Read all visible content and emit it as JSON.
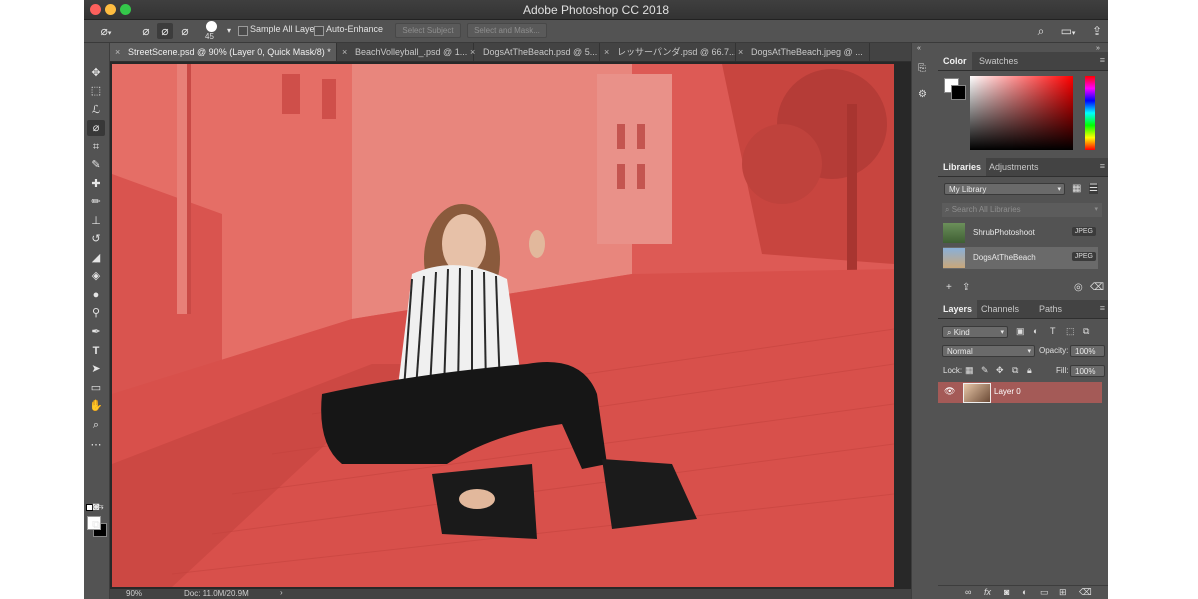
{
  "window": {
    "title": "Adobe Photoshop CC 2018"
  },
  "options_bar": {
    "brush_size": "45",
    "sample_all_layers_label": "Sample All Layers",
    "auto_enhance_label": "Auto-Enhance",
    "select_subject_label": "Select Subject",
    "select_and_mask_label": "Select and Mask..."
  },
  "tabs": [
    {
      "label": "StreetScene.psd @ 90% (Layer 0, Quick Mask/8) *"
    },
    {
      "label": "BeachVolleyball_.psd @ 1..."
    },
    {
      "label": "DogsAtTheBeach.psd @ 5..."
    },
    {
      "label": "レッサーパンダ.psd @ 66.7..."
    },
    {
      "label": "DogsAtTheBeach.jpeg @ ..."
    }
  ],
  "color_panel": {
    "tabs": [
      "Color",
      "Swatches"
    ],
    "accent": "#dd5a55"
  },
  "libraries_panel": {
    "tabs": [
      "Libraries",
      "Adjustments"
    ],
    "library_select": "My Library",
    "search_placeholder": "Search All Libraries",
    "items": [
      {
        "name": "ShrubPhotoshoot",
        "badge": "JPEG"
      },
      {
        "name": "DogsAtTheBeach",
        "badge": "JPEG"
      }
    ]
  },
  "layers_panel": {
    "tabs": [
      "Layers",
      "Channels",
      "Paths"
    ],
    "filter_kind": "Kind",
    "blend_mode": "Normal",
    "opacity_label": "Opacity:",
    "opacity_value": "100%",
    "lock_label": "Lock:",
    "fill_label": "Fill:",
    "fill_value": "100%",
    "layers": [
      {
        "name": "Layer 0"
      }
    ]
  },
  "status": {
    "zoom": "90%",
    "doc_info": "Doc: 11.0M/20.9M"
  }
}
